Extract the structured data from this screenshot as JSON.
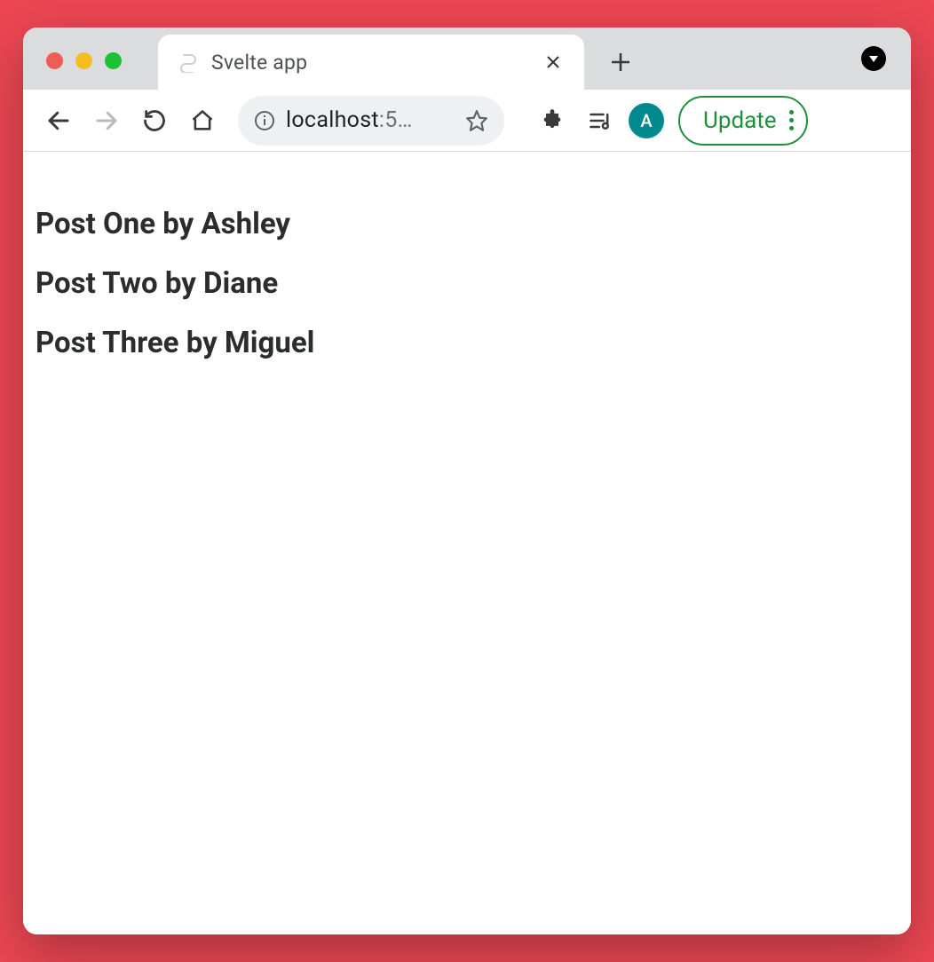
{
  "window": {
    "traffic_colors": {
      "close": "#ed5f56",
      "minimize": "#f6bd20",
      "zoom": "#1cc233"
    }
  },
  "tab": {
    "title": "Svelte app"
  },
  "toolbar": {
    "url_host": "localhost",
    "url_rest": ":5…",
    "update_label": "Update",
    "avatar_initial": "A"
  },
  "page": {
    "posts": [
      "Post One by Ashley",
      "Post Two by Diane",
      "Post Three by Miguel"
    ]
  }
}
